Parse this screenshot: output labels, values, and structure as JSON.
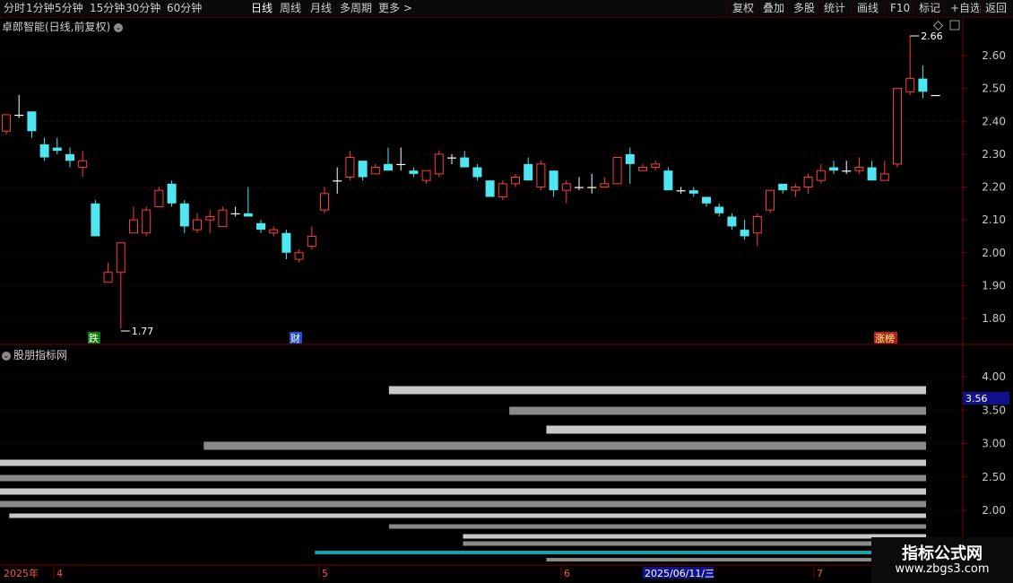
{
  "toolbar": {
    "left": [
      "分时",
      "1分钟",
      "5分钟",
      "15分钟",
      "30分钟",
      "60分钟",
      "日线",
      "周线",
      "月线",
      "多周期",
      "更多 >"
    ],
    "active_index": 6,
    "right": [
      "复权",
      "叠加",
      "多股",
      "统计",
      "画线",
      "F10",
      "标记",
      "+自选",
      "返回"
    ]
  },
  "main_chart": {
    "title": "卓郎智能(日线,前复权)",
    "y_ticks": [
      "2.60",
      "2.50",
      "2.40",
      "2.30",
      "2.20",
      "2.10",
      "2.00",
      "1.90",
      "1.80"
    ],
    "high_label": "2.66",
    "low_label": "1.77",
    "markers": [
      "跌",
      "财",
      "涨榜"
    ]
  },
  "indicator": {
    "title": "股朋指标网",
    "y_ticks": [
      "4.00",
      "3.50",
      "3.00",
      "2.50",
      "2.00"
    ],
    "current_value": "3.56"
  },
  "x_axis": {
    "labels": [
      "2025年",
      "4",
      "5",
      "6",
      "7"
    ],
    "cursor_date": "2025/06/11/三"
  },
  "watermark": {
    "title": "指标公式网",
    "url": "www.zbgs3.com"
  },
  "colors": {
    "up": "#ff3b3b",
    "down": "#4ee6f0",
    "grid": "#5a0000",
    "bg": "#000000"
  },
  "chart_data": {
    "type": "candlestick",
    "ylim": [
      1.75,
      2.68
    ],
    "candles": [
      [
        2.37,
        2.42,
        2.36,
        2.42
      ],
      [
        2.42,
        2.48,
        2.41,
        2.42
      ],
      [
        2.43,
        2.43,
        2.35,
        2.37
      ],
      [
        2.33,
        2.35,
        2.28,
        2.29
      ],
      [
        2.32,
        2.35,
        2.3,
        2.31
      ],
      [
        2.3,
        2.32,
        2.26,
        2.28
      ],
      [
        2.26,
        2.31,
        2.23,
        2.28
      ],
      [
        2.15,
        2.16,
        2.05,
        2.05
      ],
      [
        1.91,
        1.97,
        1.91,
        1.94
      ],
      [
        1.94,
        2.02,
        1.77,
        2.03
      ],
      [
        2.06,
        2.14,
        2.06,
        2.1
      ],
      [
        2.06,
        2.14,
        2.05,
        2.13
      ],
      [
        2.14,
        2.2,
        2.14,
        2.19
      ],
      [
        2.21,
        2.22,
        2.14,
        2.15
      ],
      [
        2.15,
        2.16,
        2.06,
        2.08
      ],
      [
        2.07,
        2.12,
        2.06,
        2.1
      ],
      [
        2.1,
        2.13,
        2.06,
        2.11
      ],
      [
        2.08,
        2.14,
        2.08,
        2.13
      ],
      [
        2.12,
        2.14,
        2.11,
        2.12
      ],
      [
        2.12,
        2.2,
        2.11,
        2.11
      ],
      [
        2.09,
        2.1,
        2.06,
        2.07
      ],
      [
        2.06,
        2.08,
        2.05,
        2.07
      ],
      [
        2.06,
        2.07,
        1.98,
        2.0
      ],
      [
        1.98,
        2.01,
        1.97,
        2.0
      ],
      [
        2.02,
        2.08,
        2.01,
        2.05
      ],
      [
        2.13,
        2.2,
        2.12,
        2.18
      ],
      [
        2.22,
        2.26,
        2.18,
        2.22
      ],
      [
        2.23,
        2.31,
        2.22,
        2.29
      ],
      [
        2.28,
        2.28,
        2.22,
        2.23
      ],
      [
        2.24,
        2.27,
        2.24,
        2.26
      ],
      [
        2.27,
        2.32,
        2.25,
        2.25
      ],
      [
        2.27,
        2.32,
        2.25,
        2.27
      ],
      [
        2.25,
        2.26,
        2.23,
        2.24
      ],
      [
        2.22,
        2.25,
        2.21,
        2.25
      ],
      [
        2.24,
        2.31,
        2.23,
        2.3
      ],
      [
        2.29,
        2.3,
        2.27,
        2.29
      ],
      [
        2.29,
        2.31,
        2.26,
        2.26
      ],
      [
        2.26,
        2.27,
        2.22,
        2.23
      ],
      [
        2.22,
        2.22,
        2.17,
        2.17
      ],
      [
        2.17,
        2.22,
        2.16,
        2.21
      ],
      [
        2.21,
        2.24,
        2.2,
        2.23
      ],
      [
        2.27,
        2.29,
        2.22,
        2.22
      ],
      [
        2.2,
        2.28,
        2.19,
        2.27
      ],
      [
        2.25,
        2.25,
        2.17,
        2.19
      ],
      [
        2.19,
        2.22,
        2.15,
        2.21
      ],
      [
        2.2,
        2.23,
        2.19,
        2.2
      ],
      [
        2.2,
        2.24,
        2.18,
        2.2
      ],
      [
        2.2,
        2.23,
        2.2,
        2.21
      ],
      [
        2.21,
        2.28,
        2.21,
        2.29
      ],
      [
        2.3,
        2.32,
        2.21,
        2.27
      ],
      [
        2.25,
        2.27,
        2.25,
        2.26
      ],
      [
        2.26,
        2.28,
        2.25,
        2.27
      ],
      [
        2.25,
        2.26,
        2.19,
        2.19
      ],
      [
        2.19,
        2.2,
        2.18,
        2.19
      ],
      [
        2.19,
        2.2,
        2.17,
        2.18
      ],
      [
        2.17,
        2.17,
        2.14,
        2.15
      ],
      [
        2.14,
        2.15,
        2.11,
        2.12
      ],
      [
        2.11,
        2.12,
        2.07,
        2.08
      ],
      [
        2.07,
        2.1,
        2.04,
        2.05
      ],
      [
        2.06,
        2.12,
        2.02,
        2.11
      ],
      [
        2.13,
        2.19,
        2.12,
        2.19
      ],
      [
        2.21,
        2.21,
        2.18,
        2.19
      ],
      [
        2.19,
        2.21,
        2.17,
        2.2
      ],
      [
        2.2,
        2.24,
        2.18,
        2.23
      ],
      [
        2.22,
        2.27,
        2.21,
        2.25
      ],
      [
        2.26,
        2.28,
        2.24,
        2.25
      ],
      [
        2.25,
        2.28,
        2.24,
        2.25
      ],
      [
        2.25,
        2.29,
        2.24,
        2.26
      ],
      [
        2.26,
        2.28,
        2.22,
        2.22
      ],
      [
        2.22,
        2.28,
        2.22,
        2.24
      ],
      [
        2.27,
        2.5,
        2.26,
        2.5
      ],
      [
        2.49,
        2.66,
        2.48,
        2.53
      ],
      [
        2.53,
        2.57,
        2.47,
        2.49
      ],
      [
        2.48,
        2.48,
        2.48,
        2.48
      ]
    ],
    "bars": [
      {
        "start": 0.42,
        "end": 3.8,
        "shade": "#c8c8c8"
      },
      {
        "start": 0.55,
        "end": 3.54,
        "shade": "#8a8a8a"
      },
      {
        "start": 0.59,
        "end": 3.2,
        "shade": "#c8c8c8"
      },
      {
        "start": 0.22,
        "end": 2.94,
        "shade": "#8a8a8a"
      },
      {
        "start": 0.0,
        "end": 2.71,
        "shade": "#c8c8c8"
      },
      {
        "start": 0.0,
        "end": 2.49,
        "shade": "#8a8a8a"
      },
      {
        "start": 0.0,
        "end": 2.33,
        "shade": "#c8c8c8"
      },
      {
        "start": 0.0,
        "end": 2.15,
        "shade": "#8a8a8a"
      },
      {
        "start": 0.01,
        "end": 1.97,
        "shade": "#c8c8c8"
      },
      {
        "start": 0.42,
        "end": 1.84,
        "shade": "#8a8a8a"
      },
      {
        "start": 0.5,
        "end": 1.66,
        "shade": "#c8c8c8"
      },
      {
        "start": 0.5,
        "end": 1.57,
        "shade": "#8a8a8a"
      },
      {
        "start": 0.34,
        "end": 1.43,
        "shade": "#1aa0a8"
      },
      {
        "start": 0.59,
        "end": 1.23,
        "shade": "#8a8a8a"
      }
    ]
  }
}
